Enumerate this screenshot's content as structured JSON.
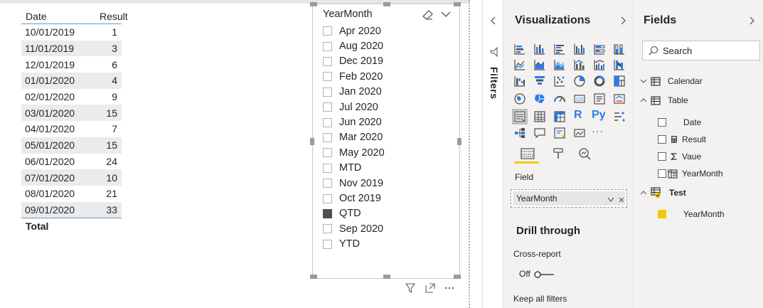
{
  "table": {
    "headers": {
      "date": "Date",
      "result": "Result"
    },
    "rows": [
      {
        "date": "10/01/2019",
        "result": "1"
      },
      {
        "date": "11/01/2019",
        "result": "3"
      },
      {
        "date": "12/01/2019",
        "result": "6"
      },
      {
        "date": "01/01/2020",
        "result": "4"
      },
      {
        "date": "02/01/2020",
        "result": "9"
      },
      {
        "date": "03/01/2020",
        "result": "15"
      },
      {
        "date": "04/01/2020",
        "result": "7"
      },
      {
        "date": "05/01/2020",
        "result": "15"
      },
      {
        "date": "06/01/2020",
        "result": "24"
      },
      {
        "date": "07/01/2020",
        "result": "10"
      },
      {
        "date": "08/01/2020",
        "result": "21"
      },
      {
        "date": "09/01/2020",
        "result": "33"
      }
    ],
    "total_label": "Total"
  },
  "slicer": {
    "title": "YearMonth",
    "items": [
      {
        "label": "Apr 2020",
        "checked": false
      },
      {
        "label": "Aug 2020",
        "checked": false
      },
      {
        "label": "Dec 2019",
        "checked": false
      },
      {
        "label": "Feb 2020",
        "checked": false
      },
      {
        "label": "Jan 2020",
        "checked": false
      },
      {
        "label": "Jul 2020",
        "checked": false
      },
      {
        "label": "Jun 2020",
        "checked": false
      },
      {
        "label": "Mar 2020",
        "checked": false
      },
      {
        "label": "May 2020",
        "checked": false
      },
      {
        "label": "MTD",
        "checked": false
      },
      {
        "label": "Nov 2019",
        "checked": false
      },
      {
        "label": "Oct 2019",
        "checked": false
      },
      {
        "label": "QTD",
        "checked": true
      },
      {
        "label": "Sep 2020",
        "checked": false
      },
      {
        "label": "YTD",
        "checked": false
      }
    ]
  },
  "filters": {
    "title": "Filters"
  },
  "visualizations": {
    "title": "Visualizations",
    "field_label": "Field",
    "field_value": "YearMonth",
    "drill_title": "Drill through",
    "cross_report_label": "Cross-report",
    "cross_report_state": "Off",
    "keep_filters_label": "Keep all filters",
    "text_icons": {
      "r": "R",
      "py": "Py",
      "more": "···"
    }
  },
  "fields": {
    "title": "Fields",
    "search_placeholder": "Search",
    "tables": [
      {
        "name": "Calendar",
        "expanded": false
      },
      {
        "name": "Table",
        "expanded": true,
        "fields": [
          {
            "name": "Date",
            "checked": false,
            "icon": "none"
          },
          {
            "name": "Result",
            "checked": false,
            "icon": "calculator-icon"
          },
          {
            "name": "Vaue",
            "checked": false,
            "icon": "sigma-icon"
          },
          {
            "name": "YearMonth",
            "checked": false,
            "icon": "column-icon"
          }
        ]
      },
      {
        "name": "Test",
        "expanded": true,
        "fields": [
          {
            "name": "YearMonth",
            "checked": true,
            "icon": "none"
          }
        ]
      }
    ]
  },
  "colors": {
    "accent": "#f2c811",
    "table_border": "#5f9dd8",
    "pane_bg": "#f3f2f1"
  }
}
